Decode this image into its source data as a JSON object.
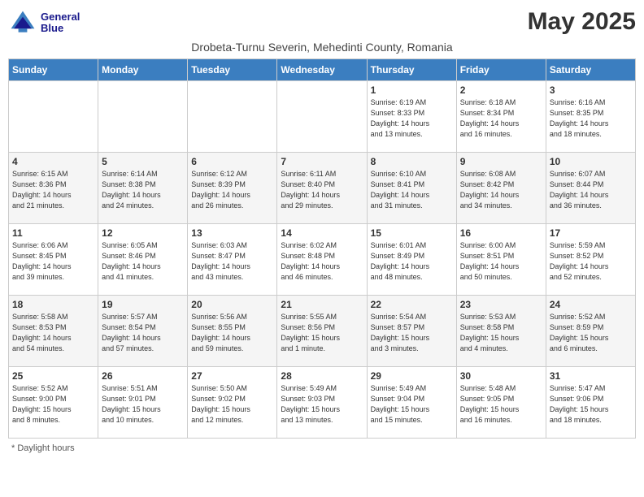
{
  "header": {
    "logo_line1": "General",
    "logo_line2": "Blue",
    "title": "May 2025",
    "subtitle": "Drobeta-Turnu Severin, Mehedinti County, Romania"
  },
  "weekdays": [
    "Sunday",
    "Monday",
    "Tuesday",
    "Wednesday",
    "Thursday",
    "Friday",
    "Saturday"
  ],
  "footer": {
    "note": "Daylight hours"
  },
  "weeks": [
    [
      {
        "day": "",
        "info": ""
      },
      {
        "day": "",
        "info": ""
      },
      {
        "day": "",
        "info": ""
      },
      {
        "day": "",
        "info": ""
      },
      {
        "day": "1",
        "info": "Sunrise: 6:19 AM\nSunset: 8:33 PM\nDaylight: 14 hours\nand 13 minutes."
      },
      {
        "day": "2",
        "info": "Sunrise: 6:18 AM\nSunset: 8:34 PM\nDaylight: 14 hours\nand 16 minutes."
      },
      {
        "day": "3",
        "info": "Sunrise: 6:16 AM\nSunset: 8:35 PM\nDaylight: 14 hours\nand 18 minutes."
      }
    ],
    [
      {
        "day": "4",
        "info": "Sunrise: 6:15 AM\nSunset: 8:36 PM\nDaylight: 14 hours\nand 21 minutes."
      },
      {
        "day": "5",
        "info": "Sunrise: 6:14 AM\nSunset: 8:38 PM\nDaylight: 14 hours\nand 24 minutes."
      },
      {
        "day": "6",
        "info": "Sunrise: 6:12 AM\nSunset: 8:39 PM\nDaylight: 14 hours\nand 26 minutes."
      },
      {
        "day": "7",
        "info": "Sunrise: 6:11 AM\nSunset: 8:40 PM\nDaylight: 14 hours\nand 29 minutes."
      },
      {
        "day": "8",
        "info": "Sunrise: 6:10 AM\nSunset: 8:41 PM\nDaylight: 14 hours\nand 31 minutes."
      },
      {
        "day": "9",
        "info": "Sunrise: 6:08 AM\nSunset: 8:42 PM\nDaylight: 14 hours\nand 34 minutes."
      },
      {
        "day": "10",
        "info": "Sunrise: 6:07 AM\nSunset: 8:44 PM\nDaylight: 14 hours\nand 36 minutes."
      }
    ],
    [
      {
        "day": "11",
        "info": "Sunrise: 6:06 AM\nSunset: 8:45 PM\nDaylight: 14 hours\nand 39 minutes."
      },
      {
        "day": "12",
        "info": "Sunrise: 6:05 AM\nSunset: 8:46 PM\nDaylight: 14 hours\nand 41 minutes."
      },
      {
        "day": "13",
        "info": "Sunrise: 6:03 AM\nSunset: 8:47 PM\nDaylight: 14 hours\nand 43 minutes."
      },
      {
        "day": "14",
        "info": "Sunrise: 6:02 AM\nSunset: 8:48 PM\nDaylight: 14 hours\nand 46 minutes."
      },
      {
        "day": "15",
        "info": "Sunrise: 6:01 AM\nSunset: 8:49 PM\nDaylight: 14 hours\nand 48 minutes."
      },
      {
        "day": "16",
        "info": "Sunrise: 6:00 AM\nSunset: 8:51 PM\nDaylight: 14 hours\nand 50 minutes."
      },
      {
        "day": "17",
        "info": "Sunrise: 5:59 AM\nSunset: 8:52 PM\nDaylight: 14 hours\nand 52 minutes."
      }
    ],
    [
      {
        "day": "18",
        "info": "Sunrise: 5:58 AM\nSunset: 8:53 PM\nDaylight: 14 hours\nand 54 minutes."
      },
      {
        "day": "19",
        "info": "Sunrise: 5:57 AM\nSunset: 8:54 PM\nDaylight: 14 hours\nand 57 minutes."
      },
      {
        "day": "20",
        "info": "Sunrise: 5:56 AM\nSunset: 8:55 PM\nDaylight: 14 hours\nand 59 minutes."
      },
      {
        "day": "21",
        "info": "Sunrise: 5:55 AM\nSunset: 8:56 PM\nDaylight: 15 hours\nand 1 minute."
      },
      {
        "day": "22",
        "info": "Sunrise: 5:54 AM\nSunset: 8:57 PM\nDaylight: 15 hours\nand 3 minutes."
      },
      {
        "day": "23",
        "info": "Sunrise: 5:53 AM\nSunset: 8:58 PM\nDaylight: 15 hours\nand 4 minutes."
      },
      {
        "day": "24",
        "info": "Sunrise: 5:52 AM\nSunset: 8:59 PM\nDaylight: 15 hours\nand 6 minutes."
      }
    ],
    [
      {
        "day": "25",
        "info": "Sunrise: 5:52 AM\nSunset: 9:00 PM\nDaylight: 15 hours\nand 8 minutes."
      },
      {
        "day": "26",
        "info": "Sunrise: 5:51 AM\nSunset: 9:01 PM\nDaylight: 15 hours\nand 10 minutes."
      },
      {
        "day": "27",
        "info": "Sunrise: 5:50 AM\nSunset: 9:02 PM\nDaylight: 15 hours\nand 12 minutes."
      },
      {
        "day": "28",
        "info": "Sunrise: 5:49 AM\nSunset: 9:03 PM\nDaylight: 15 hours\nand 13 minutes."
      },
      {
        "day": "29",
        "info": "Sunrise: 5:49 AM\nSunset: 9:04 PM\nDaylight: 15 hours\nand 15 minutes."
      },
      {
        "day": "30",
        "info": "Sunrise: 5:48 AM\nSunset: 9:05 PM\nDaylight: 15 hours\nand 16 minutes."
      },
      {
        "day": "31",
        "info": "Sunrise: 5:47 AM\nSunset: 9:06 PM\nDaylight: 15 hours\nand 18 minutes."
      }
    ]
  ]
}
